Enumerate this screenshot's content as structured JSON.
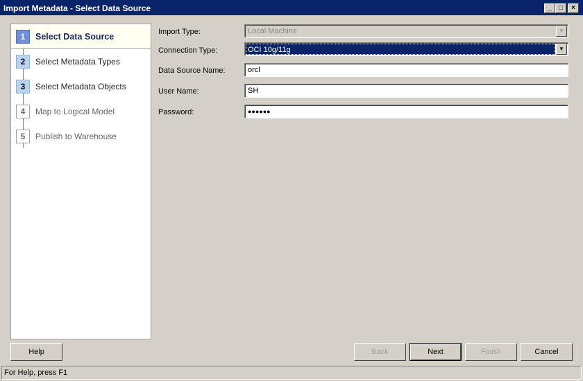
{
  "window": {
    "title": "Import Metadata - Select Data Source",
    "controls": [
      "_",
      "□",
      "×"
    ]
  },
  "steps": [
    {
      "num": "1",
      "label": "Select Data Source",
      "state": "active"
    },
    {
      "num": "2",
      "label": "Select Metadata Types",
      "state": "enabled"
    },
    {
      "num": "3",
      "label": "Select Metadata Objects",
      "state": "enabled"
    },
    {
      "num": "4",
      "label": "Map to Logical Model",
      "state": "disabled"
    },
    {
      "num": "5",
      "label": "Publish to Warehouse",
      "state": "disabled"
    }
  ],
  "form": {
    "import_type": {
      "label": "Import Type:",
      "value": "Local Machine"
    },
    "connection_type": {
      "label": "Connection Type:",
      "value": "OCI 10g/11g"
    },
    "data_source_name": {
      "label": "Data Source Name:",
      "value": "orcl"
    },
    "user_name": {
      "label": "User Name:",
      "value": "SH"
    },
    "password": {
      "label": "Password:",
      "value": "●●●●●●"
    }
  },
  "buttons": {
    "help": "Help",
    "back": "Back",
    "next": "Next",
    "finish": "Finish",
    "cancel": "Cancel"
  },
  "status": "For Help, press F1",
  "colors": {
    "titlebar": "#0a246a",
    "step_active": "#6f8fd8",
    "step_done": "#b9d4f3"
  }
}
